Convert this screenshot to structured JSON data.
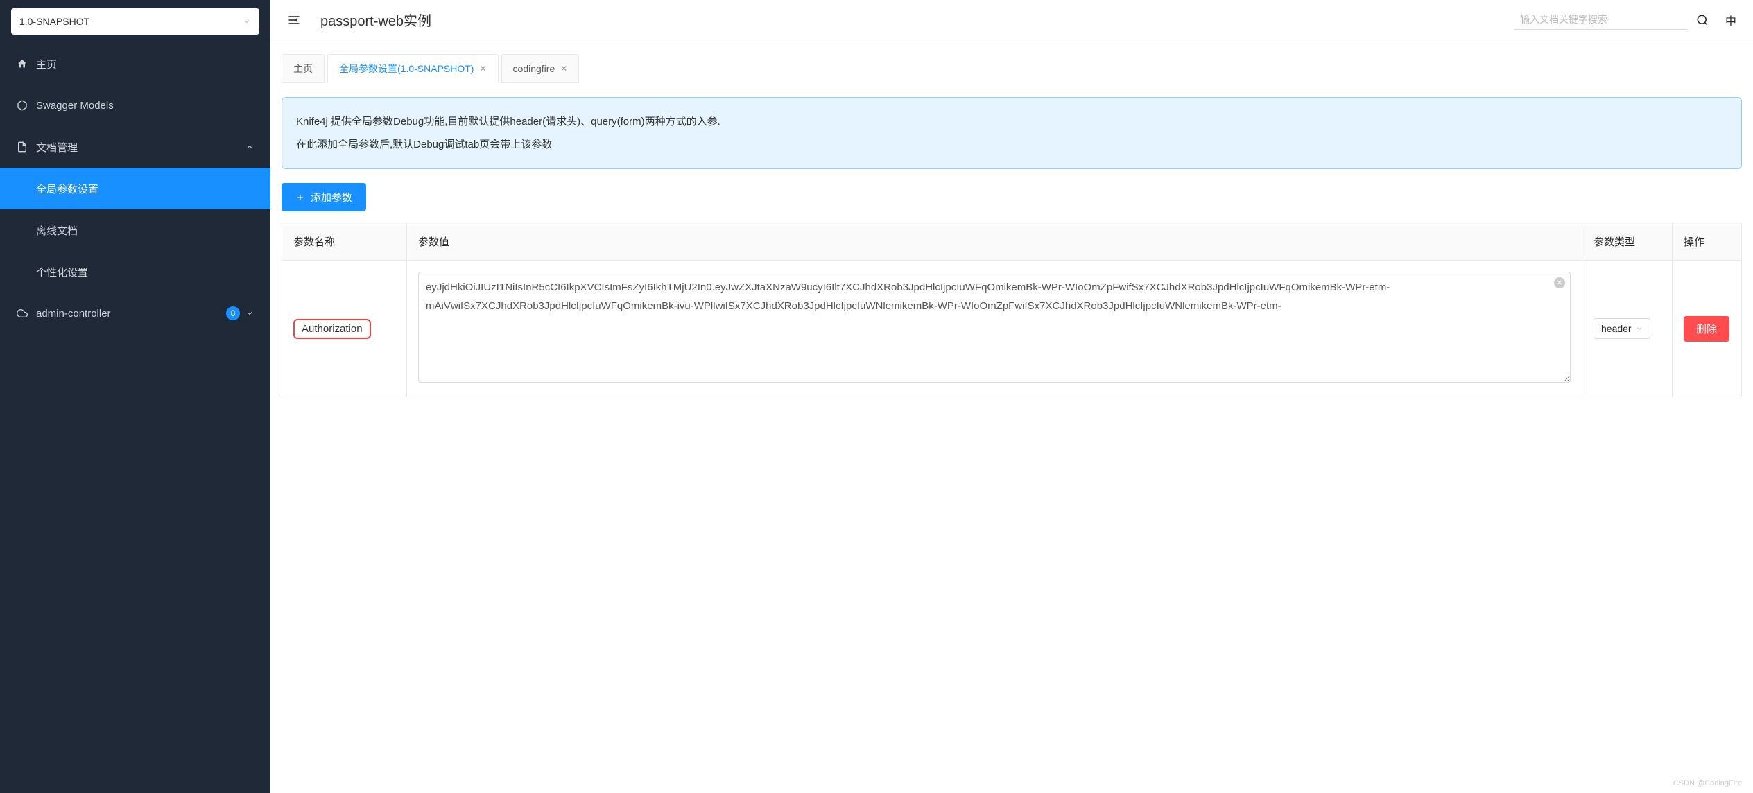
{
  "sidebar": {
    "version": "1.0-SNAPSHOT",
    "items": [
      {
        "icon": "home",
        "label": "主页"
      },
      {
        "icon": "models",
        "label": "Swagger Models"
      },
      {
        "icon": "doc",
        "label": "文档管理",
        "expanded": true,
        "children": [
          {
            "label": "全局参数设置",
            "active": true
          },
          {
            "label": "离线文档"
          },
          {
            "label": "个性化设置"
          }
        ]
      },
      {
        "icon": "cloud",
        "label": "admin-controller",
        "badge": "8",
        "expandable": true
      }
    ]
  },
  "header": {
    "title": "passport-web实例",
    "search_placeholder": "输入文档关键字搜索",
    "lang": "中"
  },
  "tabs": [
    {
      "label": "主页",
      "closable": false,
      "active": false
    },
    {
      "label": "全局参数设置(1.0-SNAPSHOT)",
      "closable": true,
      "active": true
    },
    {
      "label": "codingfire",
      "closable": true,
      "active": false
    }
  ],
  "info": {
    "line1": "Knife4j 提供全局参数Debug功能,目前默认提供header(请求头)、query(form)两种方式的入参.",
    "line2": "在此添加全局参数后,默认Debug调试tab页会带上该参数"
  },
  "add_button": "添加参数",
  "table": {
    "headers": {
      "name": "参数名称",
      "value": "参数值",
      "type": "参数类型",
      "action": "操作"
    },
    "rows": [
      {
        "name": "Authorization",
        "value": "eyJjdHkiOiJIUzI1NiIsInR5cCI6IkpXVCIsImFsZyI6IkhTMjU2In0.eyJwZXJtaXNzaW9ucyI6Ilt7XCJhdXRob3JpdHlcIjpcIuWFqOmikemBk-WPr-WIoOmZpFwifSx7XCJhdXRob3JpdHlcIjpcIuWFqOmikemBk-WPr-etm-mAiVwifSx7XCJhdXRob3JpdHlcIjpcIuWFqOmikemBk-ivu-WPllwifSx7XCJhdXRob3JpdHlcIjpcIuWNlemikemBk-WPr-WIoOmZpFwifSx7XCJhdXRob3JpdHlcIjpcIuWNlemikemBk-WPr-etm-",
        "type": "header",
        "action": "删除"
      }
    ]
  },
  "watermark": "CSDN @CodingFire"
}
